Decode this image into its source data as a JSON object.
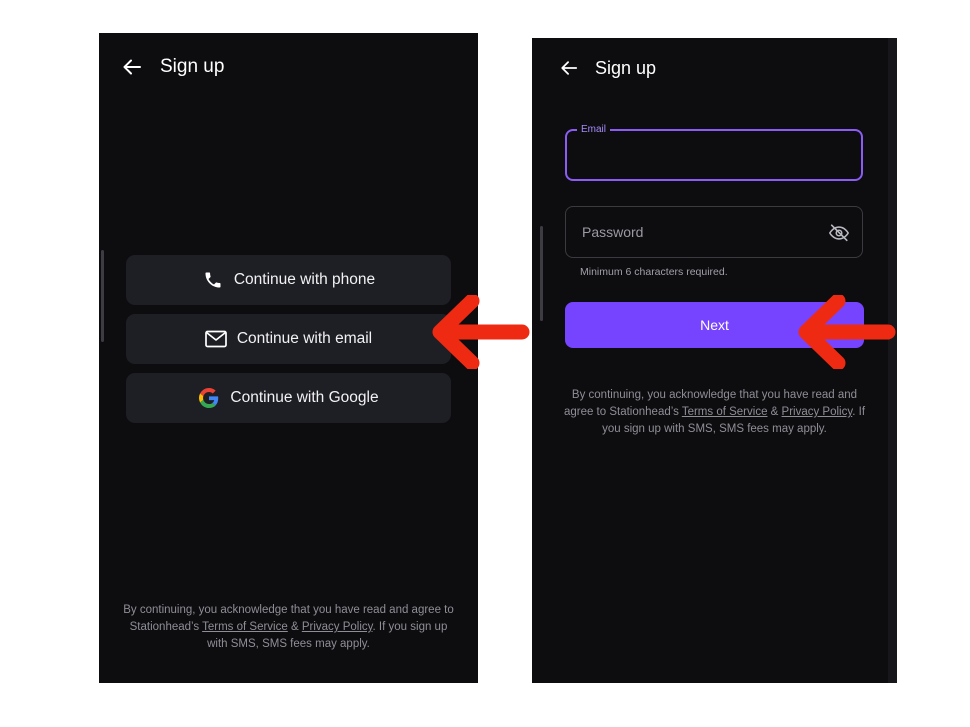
{
  "screen_left": {
    "header": {
      "title": "Sign up",
      "back_icon": "arrow-left-icon"
    },
    "buttons": [
      {
        "label": "Continue with phone",
        "icon": "phone-icon"
      },
      {
        "label": "Continue with email",
        "icon": "mail-icon"
      },
      {
        "label": "Continue with Google",
        "icon": "google-logo-icon"
      }
    ],
    "disclaimer": {
      "pre": "By continuing, you acknowledge that you have read and agree to Stationhead’s ",
      "terms": "Terms of Service",
      "amp": " & ",
      "privacy": "Privacy Policy",
      "post": ". If you sign up with SMS, SMS fees may apply."
    }
  },
  "screen_right": {
    "header": {
      "title": "Sign up",
      "back_icon": "arrow-left-icon"
    },
    "email_field": {
      "label": "Email",
      "value": ""
    },
    "password_field": {
      "placeholder": "Password",
      "value": "",
      "toggle_icon": "eye-off-icon"
    },
    "hint": "Minimum 6 characters required.",
    "next_label": "Next",
    "disclaimer": {
      "pre": "By continuing, you acknowledge that you have read and agree to Stationhead’s ",
      "terms": "Terms of Service",
      "amp": " & ",
      "privacy": "Privacy Policy",
      "post": ". If you sign up with SMS, SMS fees may apply."
    }
  },
  "colors": {
    "background": "#0d0d10",
    "button": "#1e1f24",
    "accent": "#7644ff",
    "focus_border": "#8b5cf6",
    "annotation_arrow": "#ee2a12"
  }
}
